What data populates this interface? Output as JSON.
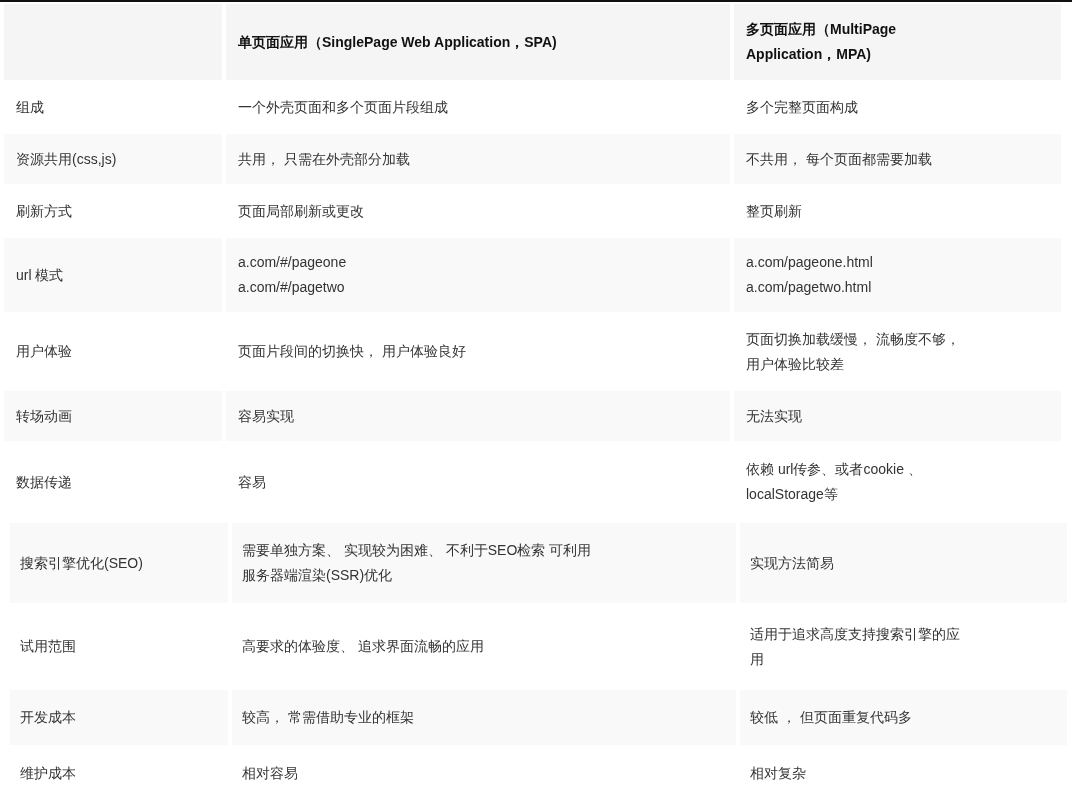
{
  "table": {
    "columns": [
      "单页面应用（SinglePage Web Application，SPA)",
      "多页面应用（MultiPage\nApplication，MPA)"
    ],
    "rows": [
      {
        "label": "组成",
        "spa": "一个外壳页面和多个页面片段组成",
        "mpa": "多个完整页面构成"
      },
      {
        "label": "资源共用(css,js)",
        "spa": "共用， 只需在外壳部分加载",
        "mpa": "不共用， 每个页面都需要加载"
      },
      {
        "label": "刷新方式",
        "spa": "页面局部刷新或更改",
        "mpa": "整页刷新"
      },
      {
        "label": "url 模式",
        "spa": "a.com/#/pageone\na.com/#/pagetwo",
        "mpa": "a.com/pageone.html\na.com/pagetwo.html"
      },
      {
        "label": "用户体验",
        "spa": "页面片段间的切换快， 用户体验良好",
        "mpa": "页面切换加载缓慢， 流畅度不够，用户体验比较差"
      },
      {
        "label": "转场动画",
        "spa": "容易实现",
        "mpa": "无法实现"
      },
      {
        "label": "数据传递",
        "spa": "容易",
        "mpa": "依赖 url传参、或者cookie 、\nlocalStorage等"
      }
    ]
  },
  "table_2": {
    "rows": [
      {
        "label": "搜索引擎优化(SEO)",
        "spa": "需要单独方案、 实现较为困难、 不利于SEO检索 可利用服务器端渲染(SSR)优化",
        "mpa": "实现方法简易"
      },
      {
        "label": "试用范围",
        "spa": "高要求的体验度、 追求界面流畅的应用",
        "mpa": "适用于追求高度支持搜索引擎的应用"
      },
      {
        "label": "开发成本",
        "spa": "较高， 常需借助专业的框架",
        "mpa": "较低 ， 但页面重复代码多"
      },
      {
        "label": "维护成本",
        "spa": "相对容易",
        "mpa": "相对复杂"
      }
    ]
  }
}
